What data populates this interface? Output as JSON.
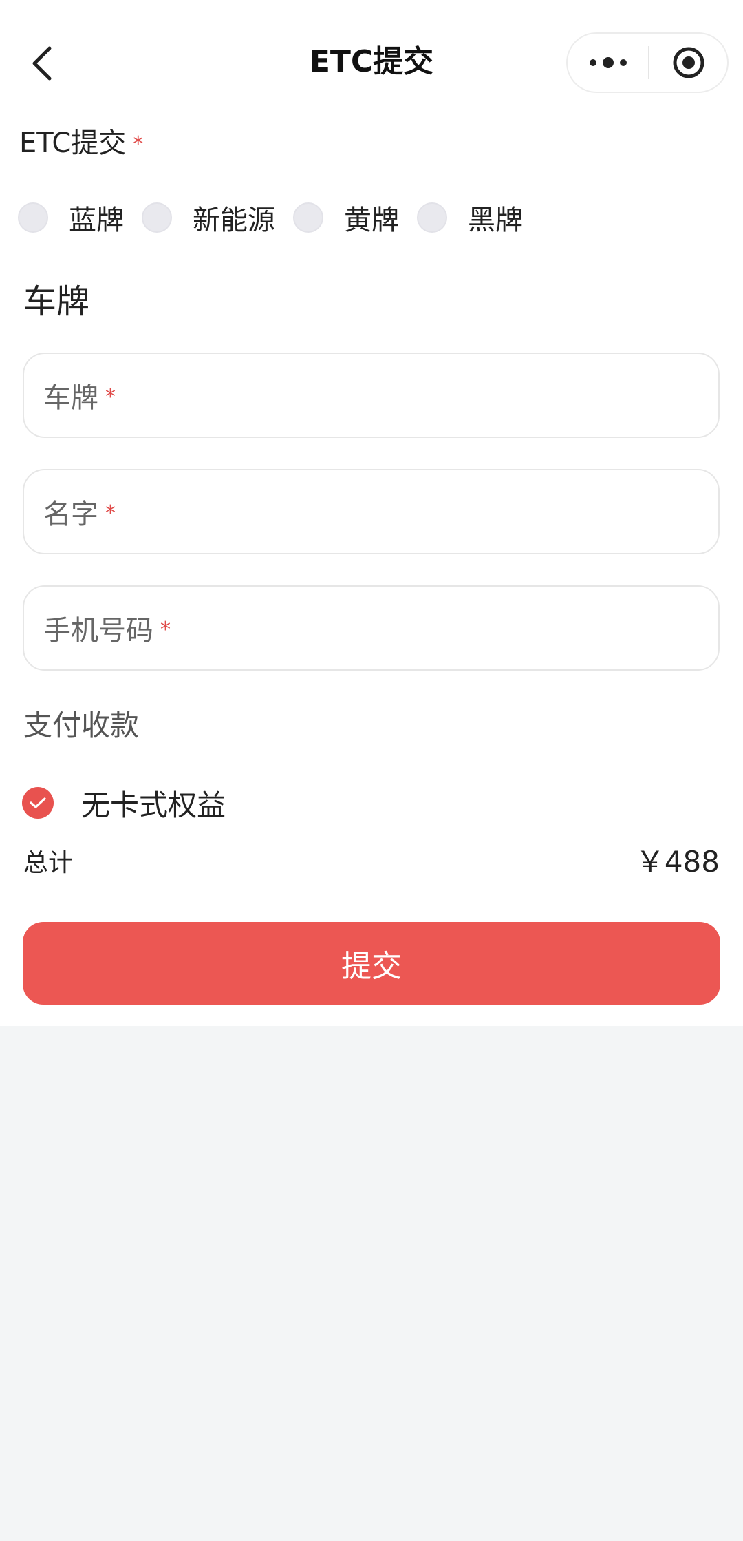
{
  "nav": {
    "title": "ETC提交"
  },
  "form": {
    "plate_type_label": "ETC提交",
    "required_mark": "*",
    "plate_types": [
      {
        "label": "蓝牌"
      },
      {
        "label": "新能源"
      },
      {
        "label": "黄牌"
      },
      {
        "label": "黑牌"
      }
    ],
    "section_title": "车牌",
    "fields": {
      "plate": {
        "placeholder": "车牌"
      },
      "name": {
        "placeholder": "名字"
      },
      "phone": {
        "placeholder": "手机号码"
      }
    },
    "payment_label": "支付收款",
    "option_label": "无卡式权益",
    "total_label": "总计",
    "total_value": "￥488",
    "submit_label": "提交"
  },
  "colors": {
    "accent": "#ec5753",
    "required": "#e04a48",
    "background": "#f3f5f6"
  },
  "icons": {
    "back": "chevron-left-icon",
    "more": "more-dots-icon",
    "close": "target-circle-icon",
    "check": "checkmark-icon"
  }
}
